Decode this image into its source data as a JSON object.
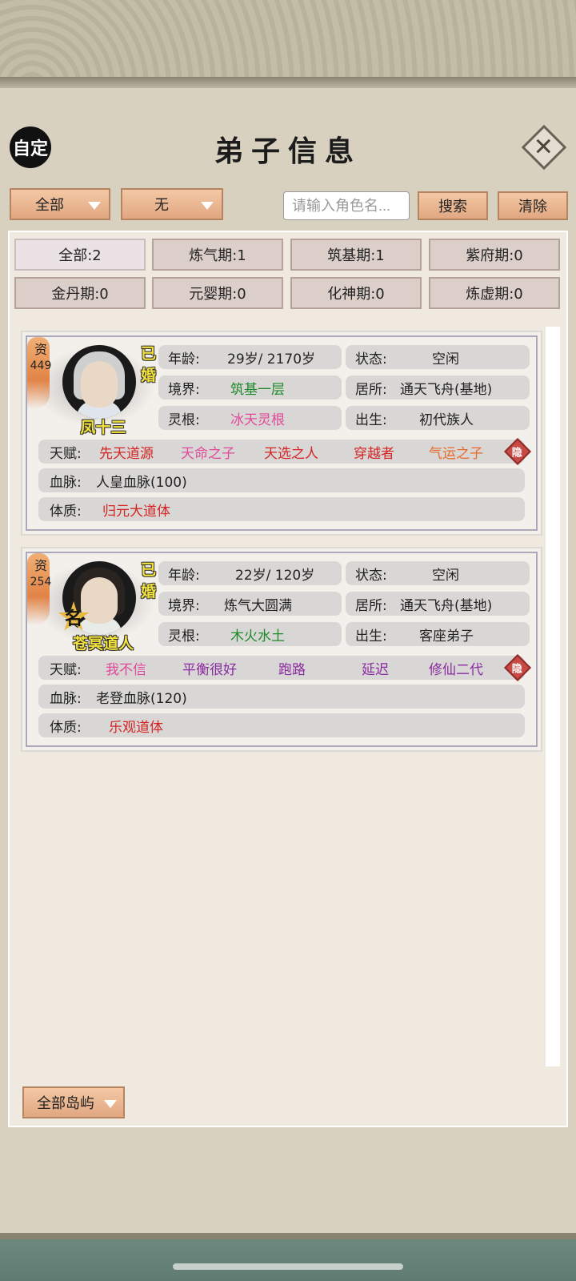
{
  "header": {
    "custom_label": "自定",
    "title": "弟子信息",
    "close_label": "✕"
  },
  "filters": {
    "scope_label": "全部",
    "tag_label": "无",
    "search_placeholder": "请输入角色名...",
    "search_label": "搜索",
    "clear_label": "清除"
  },
  "stages": [
    {
      "label": "全部:2"
    },
    {
      "label": "炼气期:1"
    },
    {
      "label": "筑基期:1"
    },
    {
      "label": "紫府期:0"
    },
    {
      "label": "金丹期:0"
    },
    {
      "label": "元婴期:0"
    },
    {
      "label": "化神期:0"
    },
    {
      "label": "炼虚期:0"
    }
  ],
  "disciples": [
    {
      "aptitude_label": "资",
      "aptitude_value": "449",
      "married": "已婚",
      "name": "凤十三",
      "age_key": "年龄:",
      "age": "29岁/ 2170岁",
      "status_key": "状态:",
      "status": "空闲",
      "realm_key": "境界:",
      "realm": "筑基一层",
      "realm_color": "#1f8a2a",
      "residence_key": "居所:",
      "residence": "通天飞舟(基地)",
      "root_key": "灵根:",
      "root": "冰天灵根",
      "root_color": "#e0489a",
      "birth_key": "出生:",
      "birth": "初代族人",
      "talent_key": "天赋:",
      "talents": [
        {
          "text": "先天道源",
          "color": "#d42424"
        },
        {
          "text": "天命之子",
          "color": "#e0489a"
        },
        {
          "text": "天选之人",
          "color": "#d42424"
        },
        {
          "text": "穿越者",
          "color": "#d42424"
        },
        {
          "text": "气运之子",
          "color": "#e86a2a"
        }
      ],
      "hide_label": "隐",
      "bloodline_key": "血脉:",
      "bloodline": "人皇血脉(100)",
      "physique_key": "体质:",
      "physique": "归元大道体",
      "physique_color": "#d42424"
    },
    {
      "aptitude_label": "资",
      "aptitude_value": "254",
      "married": "已婚",
      "fame": "名",
      "name": "苍冥道人",
      "age_key": "年龄:",
      "age": "22岁/ 120岁",
      "status_key": "状态:",
      "status": "空闲",
      "realm_key": "境界:",
      "realm": "炼气大圆满",
      "realm_color": "#222222",
      "residence_key": "居所:",
      "residence": "通天飞舟(基地)",
      "root_key": "灵根:",
      "root": "木火水土",
      "root_color": "#1f8a2a",
      "birth_key": "出生:",
      "birth": "客座弟子",
      "talent_key": "天赋:",
      "talents": [
        {
          "text": "我不信",
          "color": "#e0489a"
        },
        {
          "text": "平衡很好",
          "color": "#8a2aa0"
        },
        {
          "text": "跑路",
          "color": "#8a2aa0"
        },
        {
          "text": "延迟",
          "color": "#8a2aa0"
        },
        {
          "text": "修仙二代",
          "color": "#8a2aa0"
        }
      ],
      "hide_label": "隐",
      "bloodline_key": "血脉:",
      "bloodline": "老登血脉(120)",
      "physique_key": "体质:",
      "physique": "乐观道体",
      "physique_color": "#d42424"
    }
  ],
  "footer": {
    "island_label": "全部岛屿"
  }
}
